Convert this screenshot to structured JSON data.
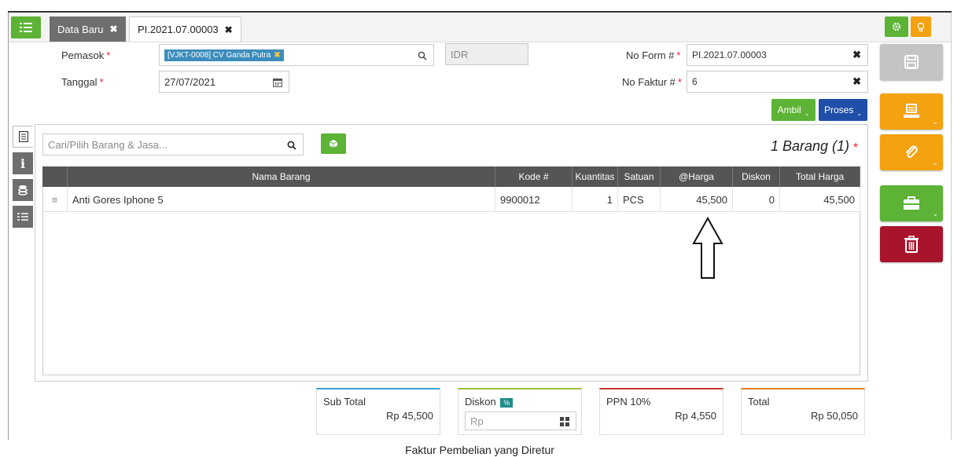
{
  "tabs": {
    "menu_icon": "hamburger-list-icon",
    "inactive_label": "Data Baru",
    "active_label": "PI.2021.07.00003",
    "close_glyph": "✖"
  },
  "form": {
    "pemasok_label": "Pemasok",
    "pemasok_value": "[VJKT-0008] CV Ganda Putra",
    "currency": "IDR",
    "tanggal_label": "Tanggal",
    "tanggal_value": "27/07/2021",
    "no_form_label": "No Form #",
    "no_form_value": "PI.2021.07.00003",
    "no_faktur_label": "No Faktur #",
    "no_faktur_value": "6",
    "required_mark": "*",
    "clear_glyph": "✖"
  },
  "actions": {
    "ambil_label": "Ambil",
    "proses_label": "Proses"
  },
  "items": {
    "search_placeholder": "Cari/Pilih Barang & Jasa...",
    "count_text": "1 Barang (1)",
    "columns": [
      "Nama Barang",
      "Kode #",
      "Kuantitas",
      "Satuan",
      "@Harga",
      "Diskon",
      "Total Harga"
    ],
    "rows": [
      {
        "nama": "Anti Gores Iphone 5",
        "kode": "9900012",
        "qty": "1",
        "satuan": "PCS",
        "harga": "45,500",
        "diskon": "0",
        "total": "45,500"
      }
    ]
  },
  "totals": {
    "subtotal_label": "Sub Total",
    "subtotal_value": "Rp 45,500",
    "diskon_label": "Diskon",
    "diskon_badge": "%",
    "diskon_placeholder": "Rp",
    "ppn_label": "PPN 10%",
    "ppn_value": "Rp 4,550",
    "total_label": "Total",
    "total_value": "Rp 50,050"
  },
  "caption": "Faktur Pembelian yang Diretur",
  "colors": {
    "green": "#5cb335",
    "orange": "#f4a20f",
    "red": "#a8142b",
    "blue": "#1f4fa8",
    "gray": "#c4c4c4"
  }
}
